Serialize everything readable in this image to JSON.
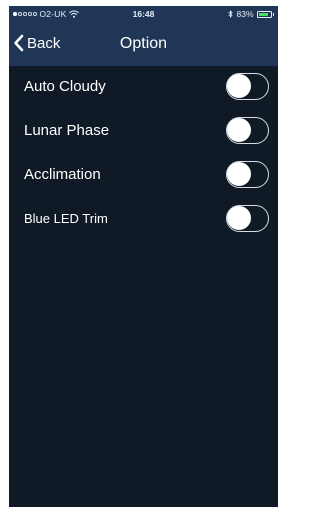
{
  "status_bar": {
    "carrier": "O2-UK",
    "time": "16:48",
    "battery_percent": "83%",
    "battery_level": 0.83,
    "signal_bars_filled": 1,
    "signal_bars_total": 5,
    "colors": {
      "background": "#1f3656",
      "battery": "#4cd964"
    }
  },
  "nav": {
    "back_label": "Back",
    "title": "Option"
  },
  "settings": [
    {
      "label": "Auto Cloudy",
      "on": false
    },
    {
      "label": "Lunar Phase",
      "on": false
    },
    {
      "label": "Acclimation",
      "on": false
    },
    {
      "label": "Blue LED Trim",
      "on": false
    }
  ],
  "colors": {
    "screen_background": "#0f1a26",
    "text": "#ffffff"
  },
  "icons": {
    "back": "chevron-left-icon",
    "wifi": "wifi-icon",
    "bluetooth": "bluetooth-icon",
    "battery": "battery-icon"
  }
}
